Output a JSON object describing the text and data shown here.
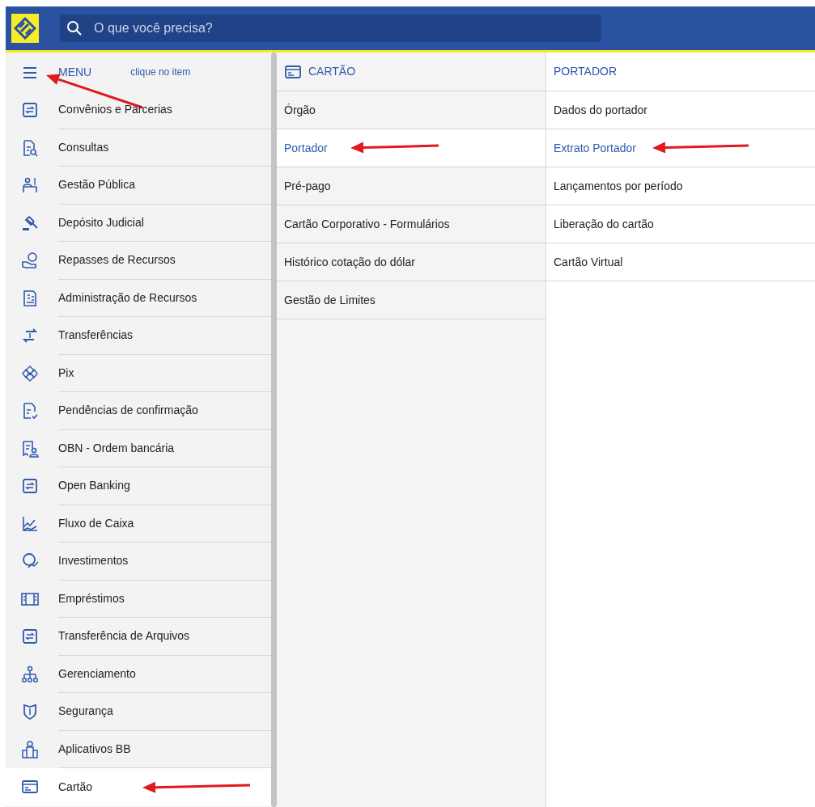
{
  "topbar": {
    "search": {
      "placeholder": "O que você precisa?"
    }
  },
  "menu": {
    "title": "MENU",
    "hint": "clique no item",
    "arrow": true,
    "items": [
      {
        "label": "Convênios e Parcerias",
        "kind": "transfer",
        "selected": false,
        "arrow": false
      },
      {
        "label": "Consultas",
        "kind": "doc-search",
        "selected": false,
        "arrow": false
      },
      {
        "label": "Gestão Pública",
        "kind": "people",
        "selected": false,
        "arrow": false
      },
      {
        "label": "Depósito Judicial",
        "kind": "gavel",
        "selected": false,
        "arrow": false
      },
      {
        "label": "Repasses de Recursos",
        "kind": "coin-hand",
        "selected": false,
        "arrow": false
      },
      {
        "label": "Administração de Recursos",
        "kind": "doc-money",
        "selected": false,
        "arrow": false
      },
      {
        "label": "Transferências",
        "kind": "arrows",
        "selected": false,
        "arrow": false
      },
      {
        "label": "Pix",
        "kind": "pix",
        "selected": false,
        "arrow": false
      },
      {
        "label": "Pendências de confirmação",
        "kind": "doc-check",
        "selected": false,
        "arrow": false
      },
      {
        "label": "OBN - Ordem bancária",
        "kind": "receipt-person",
        "selected": false,
        "arrow": false
      },
      {
        "label": "Open Banking",
        "kind": "transfer",
        "selected": false,
        "arrow": false
      },
      {
        "label": "Fluxo de Caixa",
        "kind": "chart",
        "selected": false,
        "arrow": false
      },
      {
        "label": "Investimentos",
        "kind": "coin-up",
        "selected": false,
        "arrow": false
      },
      {
        "label": "Empréstimos",
        "kind": "bills",
        "selected": false,
        "arrow": false
      },
      {
        "label": "Transferência de Arquivos",
        "kind": "transfer",
        "selected": false,
        "arrow": false
      },
      {
        "label": "Gerenciamento",
        "kind": "hierarchy",
        "selected": false,
        "arrow": false
      },
      {
        "label": "Segurança",
        "kind": "shield",
        "selected": false,
        "arrow": false
      },
      {
        "label": "Aplicativos BB",
        "kind": "building",
        "selected": false,
        "arrow": false
      },
      {
        "label": "Cartão",
        "kind": "card",
        "selected": true,
        "arrow": true
      }
    ]
  },
  "submenu": {
    "title": "CARTÃO",
    "kind": "card",
    "items": [
      {
        "label": "Órgão",
        "selected": false,
        "arrow": false
      },
      {
        "label": "Portador",
        "selected": true,
        "arrow": true
      },
      {
        "label": "Pré-pago",
        "selected": false,
        "arrow": false
      },
      {
        "label": "Cartão Corporativo - Formulários",
        "selected": false,
        "arrow": false
      },
      {
        "label": "Histórico cotação do dólar",
        "selected": false,
        "arrow": false
      },
      {
        "label": "Gestão de Limites",
        "selected": false,
        "arrow": false
      }
    ]
  },
  "detail": {
    "title": "PORTADOR",
    "items": [
      {
        "label": "Dados do portador",
        "selected": false,
        "arrow": false
      },
      {
        "label": "Extrato Portador",
        "selected": true,
        "arrow": true
      },
      {
        "label": "Lançamentos por período",
        "selected": false,
        "arrow": false
      },
      {
        "label": "Liberação do cartão",
        "selected": false,
        "arrow": false
      },
      {
        "label": "Cartão Virtual",
        "selected": false,
        "arrow": false
      }
    ]
  }
}
